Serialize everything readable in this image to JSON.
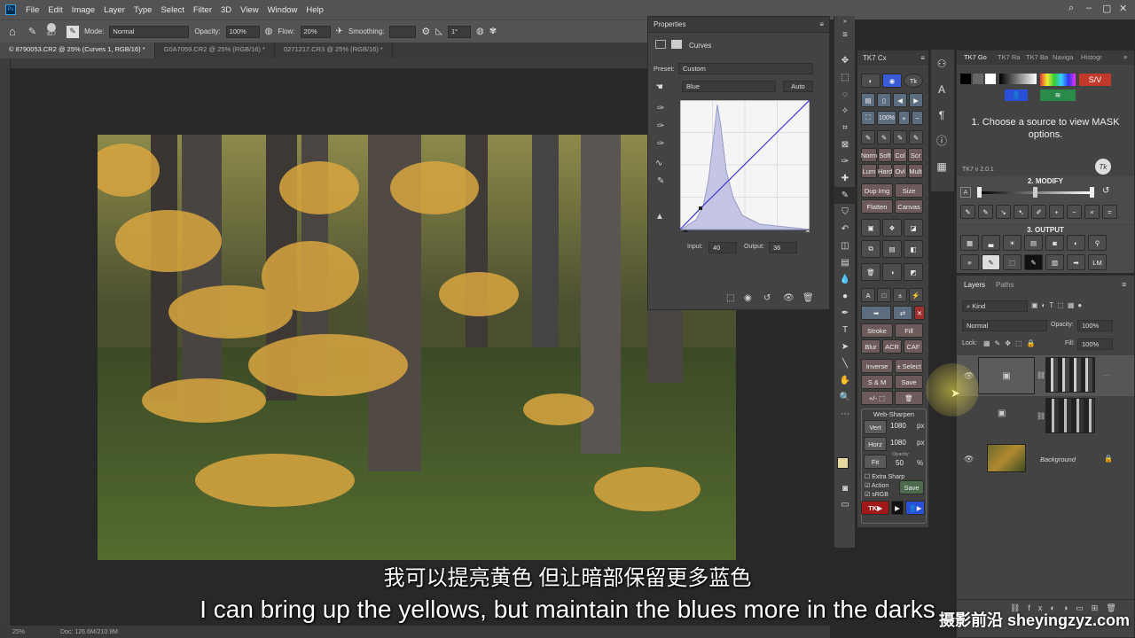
{
  "menubar": {
    "items": [
      "File",
      "Edit",
      "Image",
      "Layer",
      "Type",
      "Select",
      "Filter",
      "3D",
      "View",
      "Window",
      "Help"
    ]
  },
  "options": {
    "brush_size": "827",
    "mode_label": "Mode:",
    "mode_value": "Normal",
    "opacity_label": "Opacity:",
    "opacity_value": "100%",
    "flow_label": "Flow:",
    "flow_value": "20%",
    "smoothing_label": "Smoothing:",
    "angle_value": "1°"
  },
  "tabs": [
    "© 8790053.CR2 @ 25% (Curves 1, RGB/16) *",
    "G0A7059.CR2 @ 25% (RGB/16) *",
    "0271217.CR3 @ 25% (RGB/16) *"
  ],
  "status": {
    "zoom": "25%",
    "doc": "Doc: 126.6M/210.9M"
  },
  "properties": {
    "title": "Properties",
    "layer_type": "Curves",
    "preset_label": "Preset:",
    "preset_value": "Custom",
    "channel": "Blue",
    "auto": "Auto",
    "input_label": "Input:",
    "input_value": "40",
    "output_label": "Output:",
    "output_value": "36"
  },
  "tk7cx": {
    "title": "TK7 Cx",
    "zoom": "100%",
    "blend": [
      "Norm",
      "Soft",
      "Col",
      "Scr",
      "Lum",
      "Hard",
      "Ovl",
      "Mult"
    ],
    "dup": "Dup Img",
    "size": "Size",
    "flatten": "Flatten",
    "canvas": "Canvas",
    "stroke": "Stroke",
    "fill": "Fill",
    "blur": "Blur",
    "acr": "ACR",
    "caf": "CAF",
    "inverse": "Inverse",
    "pm_select": "± Select",
    "sm": "S & M",
    "save": "Save",
    "web_title": "Web-Sharpen",
    "vert": "Vert",
    "vert_val": "1080",
    "horz": "Horz",
    "horz_val": "1080",
    "px": "px",
    "fit": "Fit",
    "opacity_label": "Opacity",
    "opacity_val": "50",
    "pct": "%",
    "extra": "Extra Sharp",
    "action": "Action",
    "srgb": "sRGB",
    "save2": "Save",
    "tk": "TK"
  },
  "tk7go": {
    "tabs": [
      "TK7 Go",
      "TK7 Ra",
      "TK7 Ba",
      "Naviga",
      "Histogr"
    ],
    "sv": "S/V",
    "instruction": "1. Choose a source to view MASK options.",
    "version": "TK7 v 2.0.1",
    "modify": "2. MODIFY",
    "modify_a": "A",
    "output": "3. OUTPUT",
    "lm": "LM"
  },
  "layers": {
    "tabs": [
      "Layers",
      "Paths"
    ],
    "kind": "Kind",
    "blend": "Normal",
    "opacity_label": "Opacity:",
    "opacity_value": "100%",
    "lock_label": "Lock:",
    "fill_label": "Fill:",
    "fill_value": "100%",
    "background": "Background"
  },
  "subtitles": {
    "cn": "我可以提亮黄色 但让暗部保留更多蓝色",
    "en": "I can bring up the yellows, but maintain the blues more in the darks"
  },
  "watermark": "摄影前沿 sheyingzyz.com",
  "colors": {
    "accent": "#31a8ff",
    "sv": "#c0392b",
    "blue_btn": "#2a4fd8"
  }
}
